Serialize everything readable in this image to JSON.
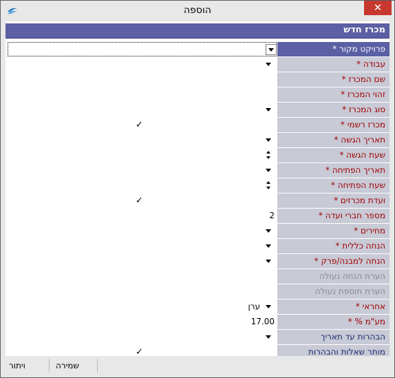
{
  "window": {
    "title": "הוספה",
    "close_label": "✕"
  },
  "header": {
    "title": "מכרז חדש"
  },
  "rows": [
    {
      "label": "* פרויקט מקור",
      "value": ""
    },
    {
      "label": "* עבודה",
      "value": ""
    },
    {
      "label": "* שם המכרז",
      "value": ""
    },
    {
      "label": "* זהוי המכרז",
      "value": ""
    },
    {
      "label": "* סוג המכרז",
      "value": ""
    },
    {
      "label": "* מכרז רשמי",
      "value": "✓"
    },
    {
      "label": "* תאריך הגשה",
      "value": ""
    },
    {
      "label": "* שעת הגשה",
      "value": ""
    },
    {
      "label": "* תאריך הפתיחה",
      "value": ""
    },
    {
      "label": "* שעת הפתיחה",
      "value": ""
    },
    {
      "label": "* ועדת מכרזים",
      "value": "✓"
    },
    {
      "label": "* מספר חברי ועדה",
      "value": "2"
    },
    {
      "label": "* מחירים",
      "value": ""
    },
    {
      "label": "* הנחה כללית",
      "value": ""
    },
    {
      "label": "* הנחה למבנה/פרק",
      "value": ""
    },
    {
      "label": "הערת הנחה נעולה",
      "value": ""
    },
    {
      "label": "הערת תוספת נעולה",
      "value": ""
    },
    {
      "label": "* אחראי",
      "value": "ערן"
    },
    {
      "label": "* % מע\"מ",
      "value": "17.00"
    },
    {
      "label": "הבהרות עד תאריך",
      "value": ""
    },
    {
      "label": "מותר שאלות והבהרות",
      "value": "✓"
    }
  ],
  "footer": {
    "save_label": "שמירה",
    "cancel_label": "ויתור"
  },
  "colors": {
    "header_bg": "#5b5fa3",
    "label_bg": "#c8cad6",
    "label_text": "#a00000",
    "close_bg": "#c7382f"
  }
}
